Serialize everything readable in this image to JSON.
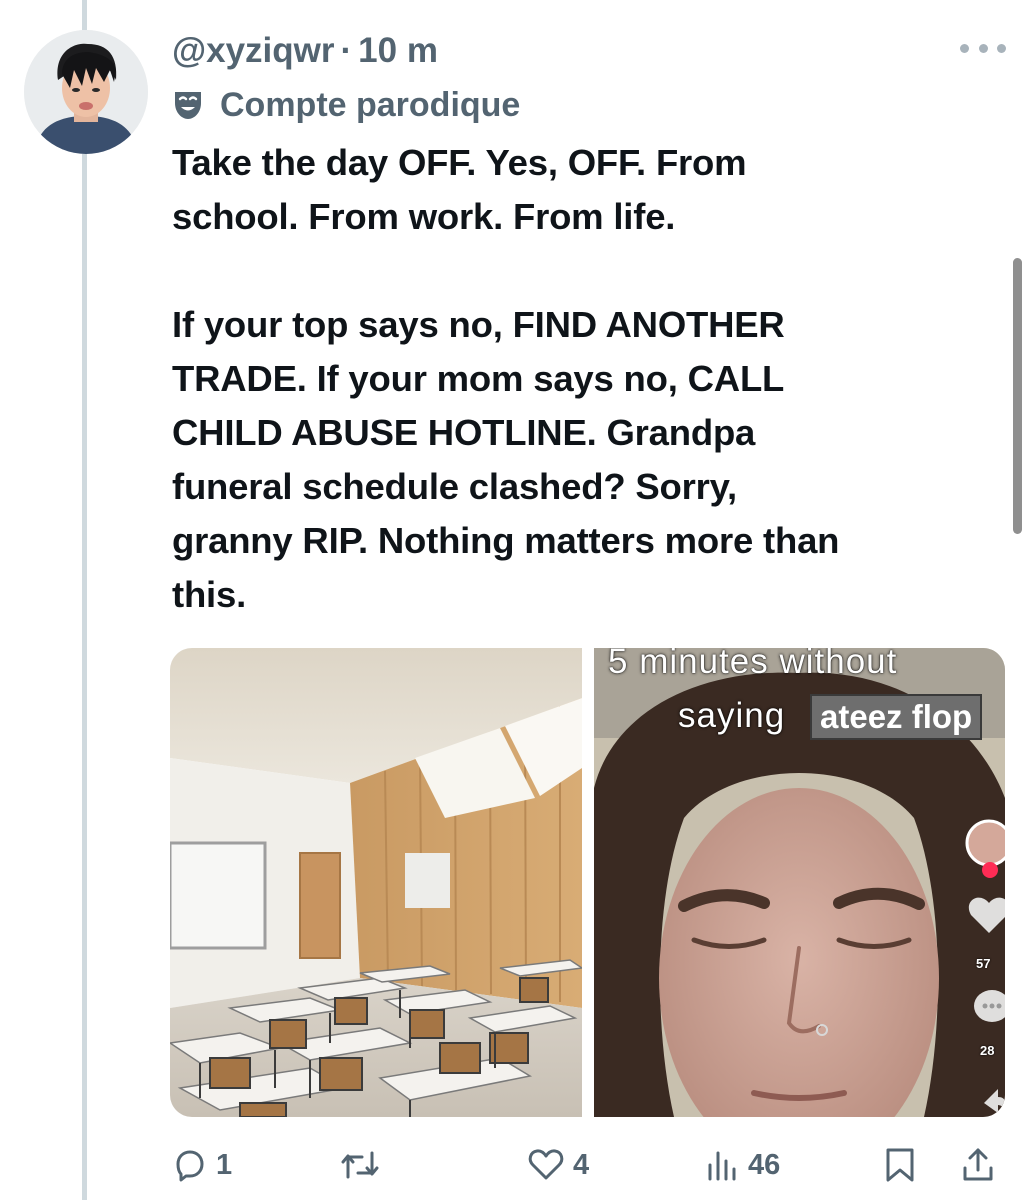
{
  "tweet": {
    "handle": "@xyziqwr",
    "separator": "·",
    "time": "10 m",
    "parody_label": "Compte parodique",
    "text_paragraph_1": "Take the day OFF. Yes, OFF. From\nschool. From work. From life.",
    "text_paragraph_2": "If your top says no, FIND ANOTHER\nTRADE. If your mom says no, CALL\nCHILD ABUSE HOTLINE. Grandpa\nfuneral schedule clashed? Sorry,\ngranny RIP. Nothing matters more than\nthis."
  },
  "media": {
    "left_image": "empty-classroom-photo",
    "right_image": "tiktok-screenshot-woman-eyes-closed",
    "right_caption_line1": "5 minutes without",
    "right_caption_line2": "saying",
    "right_caption_box": "ateez flop",
    "right_side_count_1": "57",
    "right_side_count_2": "28"
  },
  "actions": {
    "reply_count": "1",
    "retweet_count": "",
    "like_count": "4",
    "views_count": "46"
  },
  "icons": {
    "more": "more-dots-icon",
    "parody": "theater-mask-icon",
    "reply": "reply-bubble-icon",
    "retweet": "retweet-icon",
    "like": "heart-icon",
    "views": "views-bars-icon",
    "bookmark": "bookmark-icon",
    "share": "share-icon"
  },
  "colors": {
    "text": "#0f1419",
    "secondary": "#536471",
    "thread_line": "#cfd9de"
  }
}
